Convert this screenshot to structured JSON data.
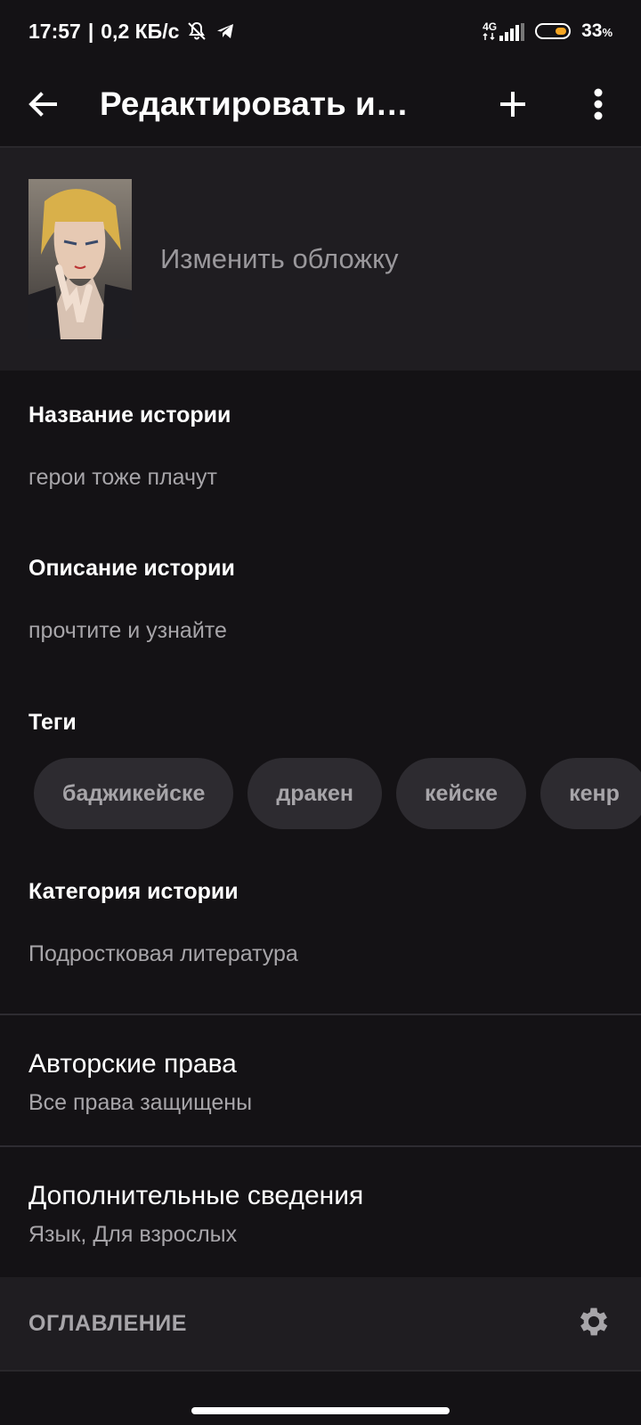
{
  "status_bar": {
    "time": "17:57",
    "separator": "|",
    "net_speed": "0,2 КБ/с",
    "network_type": "4G",
    "battery_percent": "33",
    "battery_unit": "%"
  },
  "app_bar": {
    "title": "Редактировать и…",
    "back_icon": "arrow-left-icon",
    "add_icon": "plus-icon",
    "menu_icon": "more-vertical-icon"
  },
  "cover": {
    "label": "Изменить обложку"
  },
  "fields": {
    "title_label": "Название истории",
    "title_value": "герои тоже плачут",
    "description_label": "Описание истории",
    "description_value": "прочтите и узнайте",
    "tags_label": "Теги",
    "tags": [
      "баджикейске",
      "дракен",
      "кейске",
      "кенр"
    ],
    "category_label": "Категория истории",
    "category_value": "Подростковая литература"
  },
  "copyright": {
    "title": "Авторские права",
    "value": "Все права защищены"
  },
  "extra": {
    "title": "Дополнительные сведения",
    "value": "Язык, Для взрослых"
  },
  "toc": {
    "label": "ОГЛАВЛЕНИЕ",
    "icon": "gear-icon"
  },
  "colors": {
    "background": "#141215",
    "surface": "#1f1d21",
    "tag_bg": "#2d2b30",
    "secondary_text": "#a7a5a9",
    "battery_accent": "#f5a623"
  }
}
